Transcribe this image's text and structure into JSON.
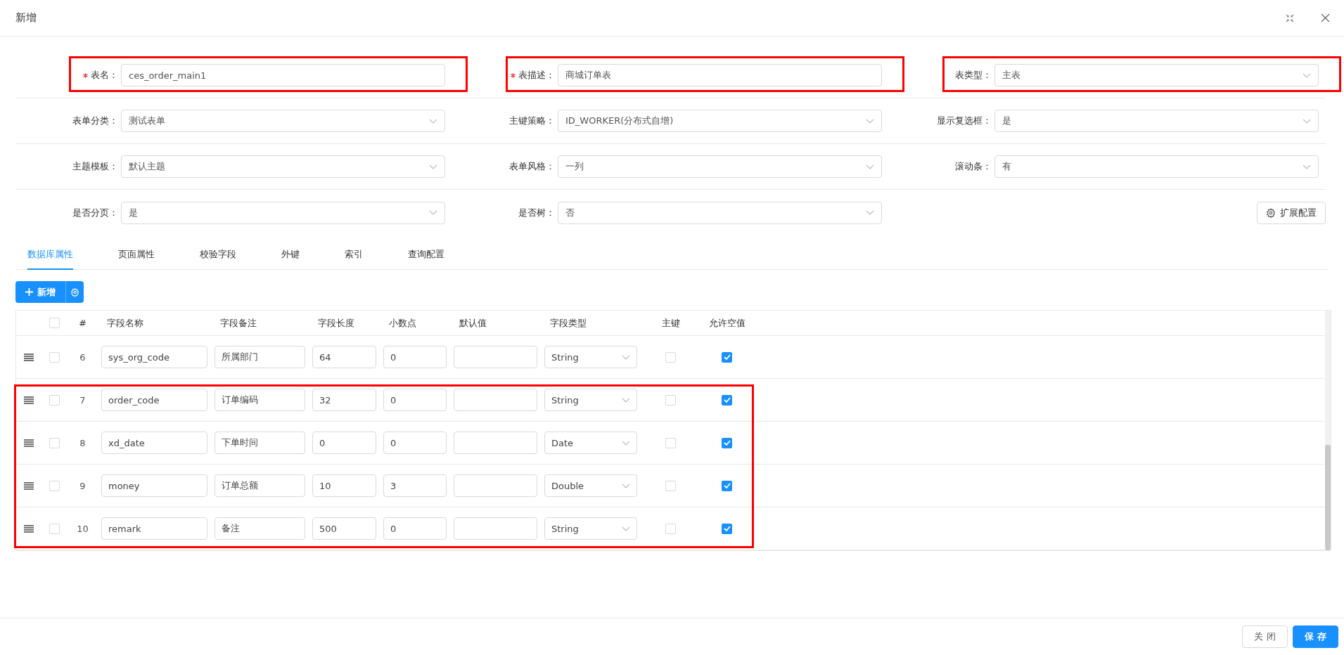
{
  "dialog": {
    "title": "新增"
  },
  "form": {
    "fields": [
      {
        "label": "表名：",
        "required": true,
        "kind": "input",
        "value": "ces_order_main1",
        "highlighted": true
      },
      {
        "label": "表描述：",
        "required": true,
        "kind": "input",
        "value": "商城订单表",
        "highlighted": true
      },
      {
        "label": "表类型：",
        "required": false,
        "kind": "select",
        "value": "主表",
        "highlighted": true
      },
      {
        "label": "表单分类：",
        "required": false,
        "kind": "select",
        "value": "测试表单",
        "highlighted": false
      },
      {
        "label": "主键策略：",
        "required": false,
        "kind": "select",
        "value": "ID_WORKER(分布式自增)",
        "highlighted": false
      },
      {
        "label": "显示复选框：",
        "required": false,
        "kind": "select",
        "value": "是",
        "highlighted": false
      },
      {
        "label": "主题模板：",
        "required": false,
        "kind": "select",
        "value": "默认主题",
        "highlighted": false
      },
      {
        "label": "表单风格：",
        "required": false,
        "kind": "select",
        "value": "一列",
        "highlighted": false
      },
      {
        "label": "滚动条：",
        "required": false,
        "kind": "select",
        "value": "有",
        "highlighted": false
      },
      {
        "label": "是否分页：",
        "required": false,
        "kind": "select",
        "value": "是",
        "highlighted": false
      },
      {
        "label": "是否树：",
        "required": false,
        "kind": "select",
        "value": "否",
        "highlighted": false
      }
    ],
    "extension_button": "扩展配置"
  },
  "tabs": [
    {
      "label": "数据库属性",
      "selected": true
    },
    {
      "label": "页面属性",
      "selected": false
    },
    {
      "label": "校验字段",
      "selected": false
    },
    {
      "label": "外键",
      "selected": false
    },
    {
      "label": "索引",
      "selected": false
    },
    {
      "label": "查询配置",
      "selected": false
    }
  ],
  "toolbar": {
    "add_button": "新增"
  },
  "table": {
    "all_checked": false,
    "columns": [
      "#",
      "字段名称",
      "字段备注",
      "字段长度",
      "小数点",
      "默认值",
      "字段类型",
      "主键",
      "允许空值"
    ],
    "rows": [
      {
        "number": "6",
        "name": "sys_org_code",
        "comment": "所属部门",
        "length": "64",
        "decimal": "0",
        "type": "String",
        "checked": false,
        "primary_key": false,
        "nullable": true,
        "highlighted": false
      },
      {
        "number": "7",
        "name": "order_code",
        "comment": "订单编码",
        "length": "32",
        "decimal": "0",
        "type": "String",
        "checked": false,
        "primary_key": false,
        "nullable": true,
        "highlighted": true
      },
      {
        "number": "8",
        "name": "xd_date",
        "comment": "下单时间",
        "length": "0",
        "decimal": "0",
        "type": "Date",
        "checked": false,
        "primary_key": false,
        "nullable": true,
        "highlighted": true
      },
      {
        "number": "9",
        "name": "money",
        "comment": "订单总额",
        "length": "10",
        "decimal": "3",
        "type": "Double",
        "checked": false,
        "primary_key": false,
        "nullable": true,
        "highlighted": true
      },
      {
        "number": "10",
        "name": "remark",
        "comment": "备注",
        "length": "500",
        "decimal": "0",
        "type": "String",
        "checked": false,
        "primary_key": false,
        "nullable": true,
        "highlighted": true
      }
    ]
  },
  "footer": {
    "buttons": [
      {
        "label": "关 闭",
        "kind": "default"
      },
      {
        "label": "保 存",
        "kind": "primary"
      }
    ]
  }
}
